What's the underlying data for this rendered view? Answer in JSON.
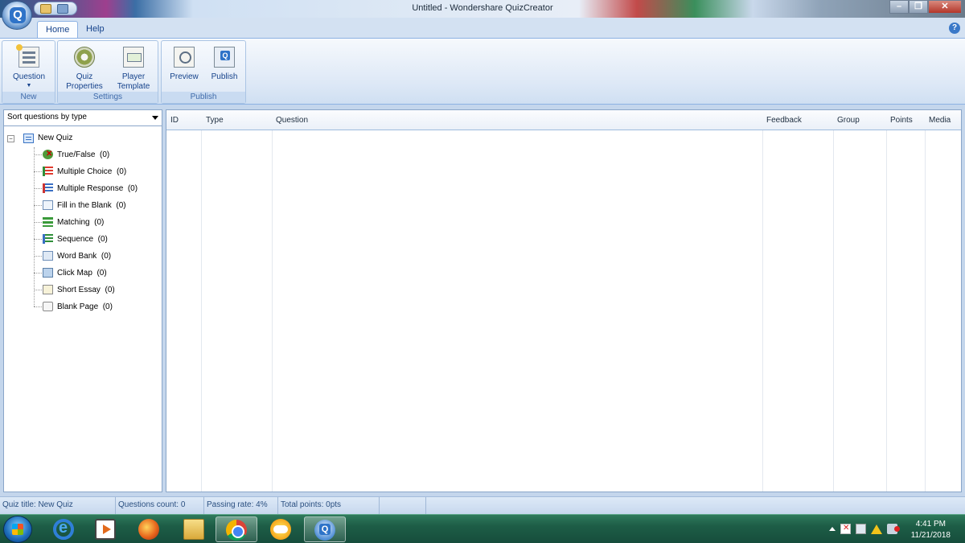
{
  "window": {
    "title": "Untitled - Wondershare QuizCreator"
  },
  "ribbon": {
    "tabs": [
      {
        "label": "Home",
        "active": true
      },
      {
        "label": "Help",
        "active": false
      }
    ],
    "groups": {
      "new": {
        "label": "New",
        "buttons": [
          {
            "label": "Question",
            "icon": "question-icon",
            "has_dropdown": true
          }
        ]
      },
      "settings": {
        "label": "Settings",
        "buttons": [
          {
            "label_line1": "Quiz",
            "label_line2": "Properties",
            "icon": "gear-icon"
          },
          {
            "label_line1": "Player",
            "label_line2": "Template",
            "icon": "player-template-icon"
          }
        ]
      },
      "publish": {
        "label": "Publish",
        "buttons": [
          {
            "label": "Preview",
            "icon": "preview-icon"
          },
          {
            "label": "Publish",
            "icon": "publish-icon"
          }
        ]
      }
    }
  },
  "left_panel": {
    "sort_select": {
      "value": "Sort questions by type"
    },
    "tree": {
      "root": {
        "label": "New Quiz",
        "expanded": true
      },
      "items": [
        {
          "label": "True/False",
          "count": "(0)",
          "icon": "true-false-icon"
        },
        {
          "label": "Multiple Choice",
          "count": "(0)",
          "icon": "multiple-choice-icon"
        },
        {
          "label": "Multiple Response",
          "count": "(0)",
          "icon": "multiple-response-icon"
        },
        {
          "label": "Fill in the Blank",
          "count": "(0)",
          "icon": "fill-blank-icon"
        },
        {
          "label": "Matching",
          "count": "(0)",
          "icon": "matching-icon"
        },
        {
          "label": "Sequence",
          "count": "(0)",
          "icon": "sequence-icon"
        },
        {
          "label": "Word Bank",
          "count": "(0)",
          "icon": "word-bank-icon"
        },
        {
          "label": "Click Map",
          "count": "(0)",
          "icon": "click-map-icon"
        },
        {
          "label": "Short Essay",
          "count": "(0)",
          "icon": "short-essay-icon"
        },
        {
          "label": "Blank Page",
          "count": "(0)",
          "icon": "blank-page-icon"
        }
      ]
    }
  },
  "question_grid": {
    "columns": [
      "ID",
      "Type",
      "Question",
      "Feedback",
      "Group",
      "Points",
      "Media"
    ],
    "rows": []
  },
  "status_bar": {
    "quiz_title": "Quiz title: New Quiz",
    "questions_count": "Questions count: 0",
    "passing_rate": "Passing rate: 4%",
    "total_points": "Total points: 0pts"
  },
  "taskbar": {
    "apps": [
      "windows-start-icon",
      "internet-explorer-icon",
      "media-player-icon",
      "firefox-icon",
      "file-explorer-icon",
      "chrome-icon",
      "sun-weather-icon",
      "quizcreator-icon"
    ],
    "active_app": "quizcreator-icon",
    "clock": {
      "time": "4:41 PM",
      "date": "11/21/2018"
    }
  }
}
